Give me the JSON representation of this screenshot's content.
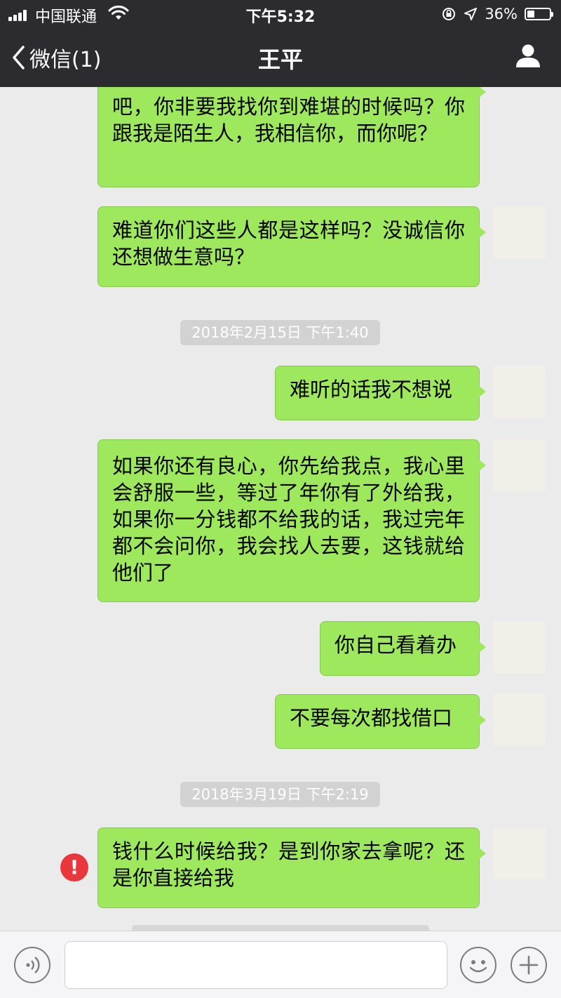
{
  "status_bar": {
    "carrier": "中国联通",
    "time": "下午5:32",
    "battery": "36%",
    "battery_level": 0.36
  },
  "nav": {
    "back_label": "微信(1)",
    "title": "王平"
  },
  "messages": [
    {
      "text": "吧，你非要我找你到难堪的时候吗？你跟我是陌生人，我相信你，而你呢？"
    },
    {
      "text": "难道你们这些人都是这样吗？没诚信你还想做生意吗？"
    },
    {
      "text": "难听的话我不想说"
    },
    {
      "text": "如果你还有良心，你先给我点，我心里会舒服一些，等过了年你有了外给我，如果你一分钱都不给我的话，我过完年都不会问你，我会找人去要，这钱就给他们了"
    },
    {
      "text": "你自己看着办"
    },
    {
      "text": "不要每次都找借口"
    },
    {
      "text": "钱什么时候给我？是到你家去拿呢？还是你直接给我"
    }
  ],
  "timestamps": [
    "2018年2月15日 下午1:40",
    "2018年3月19日 下午2:19"
  ],
  "error_mark": "!",
  "input_bar": {
    "placeholder": ""
  },
  "colors": {
    "bubble": "#9de85c",
    "nav_bg": "#2b2b30",
    "chat_bg": "#ebebeb",
    "error": "#e8383c"
  }
}
